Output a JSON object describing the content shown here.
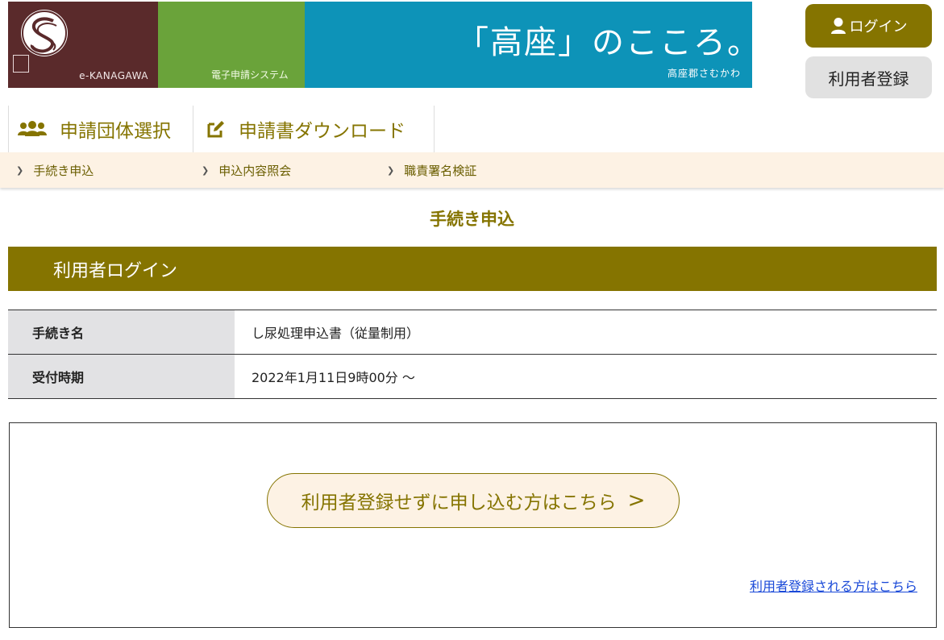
{
  "banner": {
    "org_label": "e-KANAGAWA",
    "system_label": "電子申請システム",
    "slogan": "「高座」のこころ。",
    "slogan_sub": "高座郡さむかわ",
    "colors": {
      "seg1": "#5a2a2b",
      "seg2": "#6aa33a",
      "seg3": "#0d93b8"
    }
  },
  "header": {
    "login_label": "ログイン",
    "register_label": "利用者登録"
  },
  "nav": {
    "items": [
      {
        "label": "申請団体選択",
        "icon": "group-icon"
      },
      {
        "label": "申請書ダウンロード",
        "icon": "edit-document-icon"
      }
    ]
  },
  "subnav": {
    "items": [
      {
        "label": "手続き申込"
      },
      {
        "label": "申込内容照会"
      },
      {
        "label": "職責署名検証"
      }
    ]
  },
  "page": {
    "title": "手続き申込",
    "section_title": "利用者ログイン"
  },
  "info": {
    "rows": [
      {
        "label": "手続き名",
        "value": "し尿処理申込書（従量制用）"
      },
      {
        "label": "受付時期",
        "value": "2022年1月11日9時00分 ～"
      }
    ]
  },
  "actions": {
    "guest_button": "利用者登録せずに申し込む方はこちら",
    "register_link": "利用者登録される方はこちら"
  },
  "theme": {
    "accent": "#857400",
    "subnav_bg": "#fdf2e4",
    "link": "#1a49d8"
  }
}
